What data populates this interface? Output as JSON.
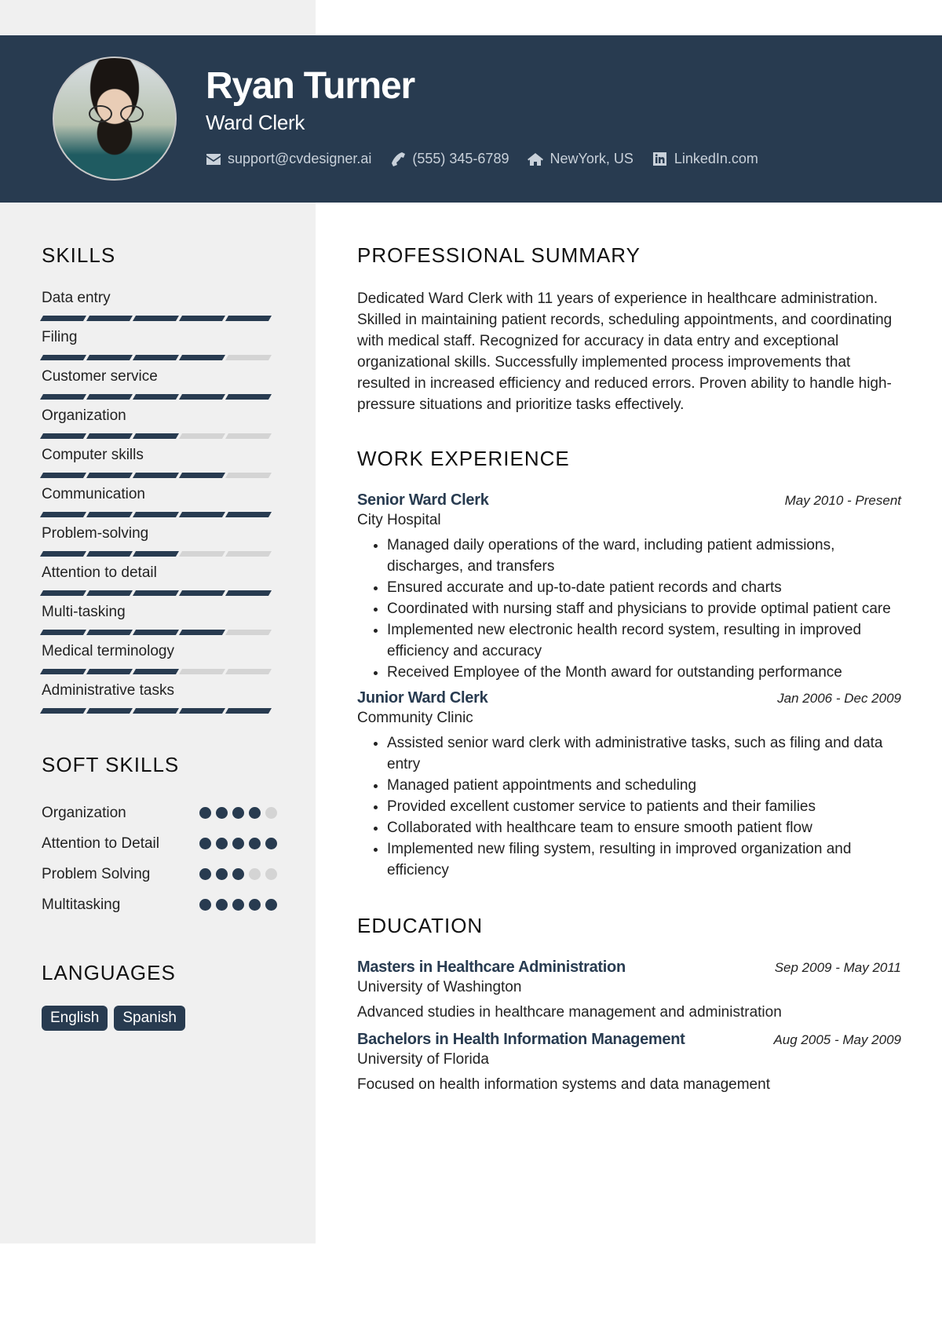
{
  "header": {
    "name": "Ryan Turner",
    "title": "Ward Clerk",
    "contacts": [
      {
        "icon": "envelope-icon",
        "text": "support@cvdesigner.ai"
      },
      {
        "icon": "phone-icon",
        "text": "(555) 345-6789"
      },
      {
        "icon": "home-icon",
        "text": "NewYork, US"
      },
      {
        "icon": "linkedin-icon",
        "text": "LinkedIn.com"
      }
    ]
  },
  "colors": {
    "accent": "#283b50",
    "sidebar": "#f0f0f0",
    "inactive": "#d4d4d4"
  },
  "sidebar": {
    "skills_heading": "SKILLS",
    "skills": [
      {
        "name": "Data entry",
        "level": 5,
        "max": 5
      },
      {
        "name": "Filing",
        "level": 4,
        "max": 5
      },
      {
        "name": "Customer service",
        "level": 5,
        "max": 5
      },
      {
        "name": "Organization",
        "level": 3,
        "max": 5
      },
      {
        "name": "Computer skills",
        "level": 4,
        "max": 5
      },
      {
        "name": "Communication",
        "level": 5,
        "max": 5
      },
      {
        "name": "Problem-solving",
        "level": 3,
        "max": 5
      },
      {
        "name": "Attention to detail",
        "level": 5,
        "max": 5
      },
      {
        "name": "Multi-tasking",
        "level": 4,
        "max": 5
      },
      {
        "name": "Medical terminology",
        "level": 3,
        "max": 5
      },
      {
        "name": "Administrative tasks",
        "level": 5,
        "max": 5
      }
    ],
    "soft_skills_heading": "SOFT SKILLS",
    "soft_skills": [
      {
        "name": "Organization",
        "level": 4,
        "max": 5
      },
      {
        "name": "Attention to Detail",
        "level": 5,
        "max": 5
      },
      {
        "name": "Problem Solving",
        "level": 3,
        "max": 5
      },
      {
        "name": "Multitasking",
        "level": 5,
        "max": 5
      }
    ],
    "languages_heading": "LANGUAGES",
    "languages": [
      "English",
      "Spanish"
    ]
  },
  "main": {
    "summary_heading": "PROFESSIONAL SUMMARY",
    "summary": "Dedicated Ward Clerk with 11 years of experience in healthcare administration. Skilled in maintaining patient records, scheduling appointments, and coordinating with medical staff. Recognized for accuracy in data entry and exceptional organizational skills. Successfully implemented process improvements that resulted in increased efficiency and reduced errors. Proven ability to handle high-pressure situations and prioritize tasks effectively.",
    "work_heading": "WORK EXPERIENCE",
    "jobs": [
      {
        "role": "Senior Ward Clerk",
        "dates": "May 2010 - Present",
        "org": "City Hospital",
        "bullets": [
          "Managed daily operations of the ward, including patient admissions, discharges, and transfers",
          "Ensured accurate and up-to-date patient records and charts",
          "Coordinated with nursing staff and physicians to provide optimal patient care",
          "Implemented new electronic health record system, resulting in improved efficiency and accuracy",
          "Received Employee of the Month award for outstanding performance"
        ]
      },
      {
        "role": "Junior Ward Clerk",
        "dates": "Jan 2006 - Dec 2009",
        "org": "Community Clinic",
        "bullets": [
          "Assisted senior ward clerk with administrative tasks, such as filing and data entry",
          "Managed patient appointments and scheduling",
          "Provided excellent customer service to patients and their families",
          "Collaborated with healthcare team to ensure smooth patient flow",
          "Implemented new filing system, resulting in improved organization and efficiency"
        ]
      }
    ],
    "education_heading": "EDUCATION",
    "education": [
      {
        "degree": "Masters in Healthcare Administration",
        "dates": "Sep 2009 - May 2011",
        "school": "University of Washington",
        "description": "Advanced studies in healthcare management and administration"
      },
      {
        "degree": "Bachelors in Health Information Management",
        "dates": "Aug 2005 - May 2009",
        "school": "University of Florida",
        "description": "Focused on health information systems and data management"
      }
    ]
  }
}
